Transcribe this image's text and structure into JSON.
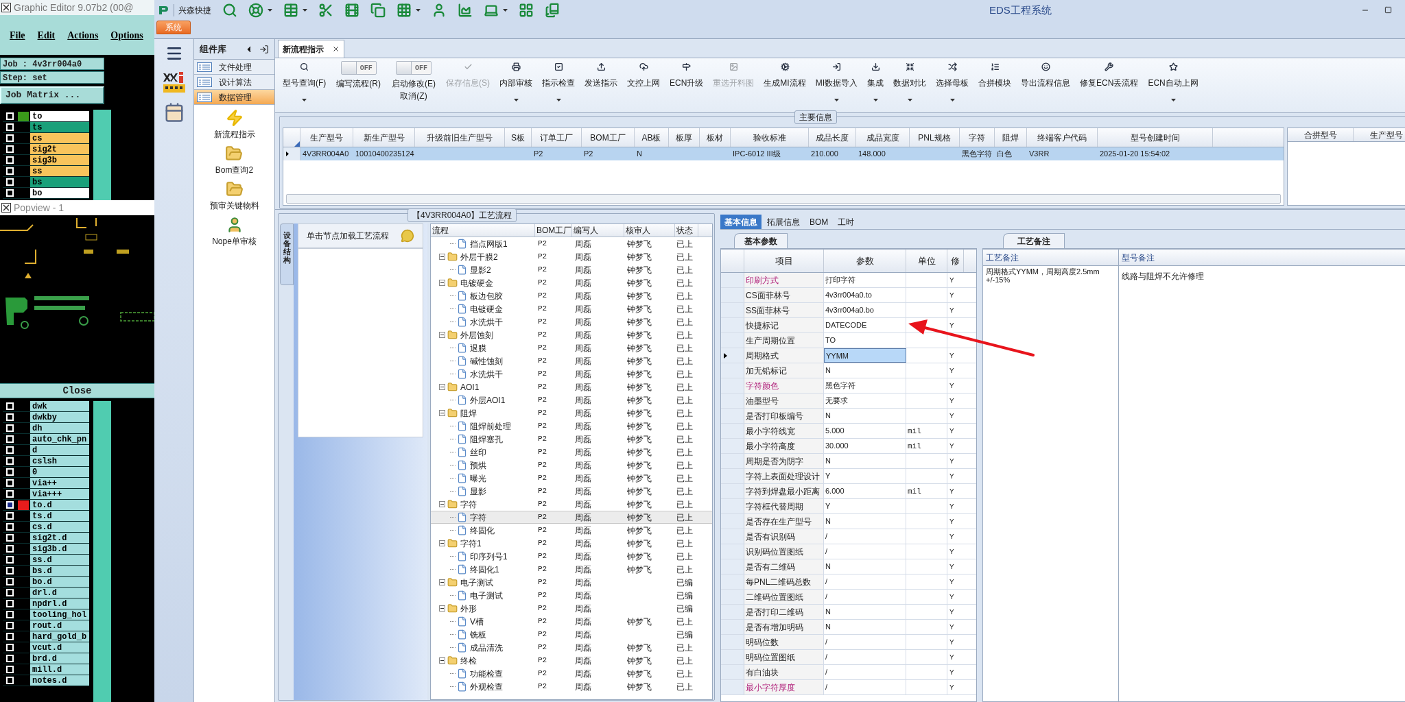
{
  "graphic_editor": {
    "title": "Graphic Editor 9.07b2 (00@",
    "menu": [
      "File",
      "Edit",
      "Actions",
      "Options"
    ],
    "job": "Job : 4v3rr004a0",
    "step": "Step: set",
    "matrix_button": "Job Matrix ...",
    "layers": [
      {
        "name": "to",
        "color": "#ffffff",
        "displayed": true,
        "selected": false
      },
      {
        "name": "ts",
        "color": "#1aa07a",
        "displayed": false,
        "selected": false
      },
      {
        "name": "cs",
        "color": "#f8c45c",
        "displayed": false,
        "selected": false
      },
      {
        "name": "sig2t",
        "color": "#f8c45c",
        "displayed": false,
        "selected": false
      },
      {
        "name": "sig3b",
        "color": "#f8c45c",
        "displayed": false,
        "selected": false
      },
      {
        "name": "ss",
        "color": "#f8c45c",
        "displayed": false,
        "selected": false
      },
      {
        "name": "bs",
        "color": "#1aa07a",
        "displayed": false,
        "selected": false
      },
      {
        "name": "bo",
        "color": "#ffffff",
        "displayed": false,
        "selected": false
      }
    ],
    "popview_title": "Popview - 1",
    "close_button": "Close",
    "layers_2": [
      {
        "name": "dwk",
        "selected": false,
        "displayed": false
      },
      {
        "name": "dwkby",
        "selected": false,
        "displayed": false
      },
      {
        "name": "dh",
        "selected": false,
        "displayed": false
      },
      {
        "name": "auto_chk_pn",
        "selected": false,
        "displayed": false
      },
      {
        "name": "d",
        "selected": false,
        "displayed": false
      },
      {
        "name": "cslsh",
        "selected": false,
        "displayed": false
      },
      {
        "name": "0",
        "selected": false,
        "displayed": false
      },
      {
        "name": "via++",
        "selected": false,
        "displayed": false
      },
      {
        "name": "via+++",
        "selected": false,
        "displayed": false
      },
      {
        "name": "to.d",
        "selected": true,
        "displayed": true
      },
      {
        "name": "ts.d",
        "selected": false,
        "displayed": false
      },
      {
        "name": "cs.d",
        "selected": false,
        "displayed": false
      },
      {
        "name": "sig2t.d",
        "selected": false,
        "displayed": false
      },
      {
        "name": "sig3b.d",
        "selected": false,
        "displayed": false
      },
      {
        "name": "ss.d",
        "selected": false,
        "displayed": false
      },
      {
        "name": "bs.d",
        "selected": false,
        "displayed": false
      },
      {
        "name": "bo.d",
        "selected": false,
        "displayed": false
      },
      {
        "name": "drl.d",
        "selected": false,
        "displayed": false
      },
      {
        "name": "npdrl.d",
        "selected": false,
        "displayed": false
      },
      {
        "name": "tooling_hol",
        "selected": false,
        "displayed": false
      },
      {
        "name": "rout.d",
        "selected": false,
        "displayed": false
      },
      {
        "name": "hard_gold_b",
        "selected": false,
        "displayed": false
      },
      {
        "name": "vcut.d",
        "selected": false,
        "displayed": false
      },
      {
        "name": "brd.d",
        "selected": false,
        "displayed": false
      },
      {
        "name": "mill.d",
        "selected": false,
        "displayed": false
      },
      {
        "name": "notes.d",
        "selected": false,
        "displayed": false
      }
    ]
  },
  "app": {
    "brand": "兴森快捷",
    "title": "EDS工程系统",
    "system_tab": "系统"
  },
  "library": {
    "title": "组件库",
    "items": [
      {
        "label": "文件处理",
        "selected": false
      },
      {
        "label": "设计算法",
        "selected": false
      },
      {
        "label": "数据管理",
        "selected": true
      }
    ],
    "tools": [
      "新流程指示",
      "Bom查询2",
      "预审关键物料",
      "Nope单审核"
    ]
  },
  "doc_tab": {
    "label": "新流程指示"
  },
  "ribbon": [
    {
      "kind": "button",
      "label": "型号查询(F)",
      "dropdown": true,
      "disabled": false
    },
    {
      "kind": "toggle",
      "label": "编写流程(R)",
      "on": false,
      "state_text": "OFF"
    },
    {
      "kind": "toggle",
      "label": "启动修改(E)",
      "second_line": "取消(Z)",
      "on": false,
      "state_text": "OFF"
    },
    {
      "kind": "button",
      "label": "保存信息(S)",
      "dropdown": false,
      "disabled": true
    },
    {
      "kind": "button",
      "label": "内部审核",
      "dropdown": true,
      "disabled": false
    },
    {
      "kind": "button",
      "label": "指示检查",
      "dropdown": true,
      "disabled": false
    },
    {
      "kind": "button",
      "label": "发送指示",
      "dropdown": false,
      "disabled": false
    },
    {
      "kind": "button",
      "label": "文控上网",
      "dropdown": false,
      "disabled": false
    },
    {
      "kind": "button",
      "label": "ECN升级",
      "dropdown": false,
      "disabled": false
    },
    {
      "kind": "button",
      "label": "重选开料图",
      "dropdown": false,
      "disabled": true
    },
    {
      "kind": "button",
      "label": "生成MI流程",
      "dropdown": false,
      "disabled": false
    },
    {
      "kind": "button",
      "label": "MI数据导入",
      "dropdown": true,
      "disabled": false
    },
    {
      "kind": "button",
      "label": "集成",
      "dropdown": true,
      "disabled": false
    },
    {
      "kind": "button",
      "label": "数据对比",
      "dropdown": true,
      "disabled": false
    },
    {
      "kind": "button",
      "label": "选择母板",
      "dropdown": true,
      "disabled": false
    },
    {
      "kind": "button",
      "label": "合拼模块",
      "dropdown": false,
      "disabled": false
    },
    {
      "kind": "button",
      "label": "导出流程信息",
      "dropdown": false,
      "disabled": false
    },
    {
      "kind": "button",
      "label": "修复ECN丢流程",
      "dropdown": false,
      "disabled": false
    },
    {
      "kind": "button",
      "label": "ECN自动上网",
      "dropdown": true,
      "disabled": false
    }
  ],
  "main_info": {
    "title": "主要信息",
    "columns": [
      "生产型号",
      "新生产型号",
      "升级前旧生产型号",
      "S板",
      "订单工厂",
      "BOM工厂",
      "AB板",
      "板厚",
      "板材",
      "验收标准",
      "成品长度",
      "成品宽度",
      "PNL规格",
      "字符",
      "阻焊",
      "终端客户代码",
      "型号创建时间"
    ],
    "rows": [
      {
        "selected": true,
        "cells": [
          "4V3RR004A0",
          "10010400235124",
          null,
          null,
          "P2",
          "P2",
          "N",
          null,
          null,
          "IPC-6012 III级",
          "210.000",
          "148.000",
          null,
          "黑色字符",
          "白色",
          "V3RR",
          "2025-01-20 15:54:02"
        ]
      }
    ],
    "side_columns": [
      "合拼型号",
      "生产型号"
    ]
  },
  "process": {
    "title": "【4V3RR004A0】工艺流程",
    "side_tab": "设备结构",
    "hint": "单击节点加载工艺流程",
    "columns": [
      "流程",
      "BOM工厂",
      "编写人",
      "核审人",
      "状态"
    ],
    "tree": [
      {
        "children": [
          {
            "label": "挡点网版1",
            "selected": false,
            "bom": "P2",
            "writer": "周磊",
            "reviewer": "钟梦飞",
            "status": "已上"
          }
        ]
      },
      {
        "label": "外层干膜2",
        "kind": "folder",
        "expanded": true,
        "selected": false,
        "bom": "P2",
        "writer": "周磊",
        "reviewer": "钟梦飞",
        "status": "已上",
        "children": [
          {
            "label": "显影2",
            "selected": false,
            "bom": "P2",
            "writer": "周磊",
            "reviewer": "钟梦飞",
            "status": "已上"
          }
        ]
      },
      {
        "label": "电镀硬金",
        "kind": "folder",
        "expanded": true,
        "selected": false,
        "bom": "P2",
        "writer": "周磊",
        "reviewer": "钟梦飞",
        "status": "已上",
        "children": [
          {
            "label": "板边包胶",
            "selected": false,
            "bom": "P2",
            "writer": "周磊",
            "reviewer": "钟梦飞",
            "status": "已上"
          },
          {
            "label": "电镀硬金",
            "selected": false,
            "bom": "P2",
            "writer": "周磊",
            "reviewer": "钟梦飞",
            "status": "已上"
          },
          {
            "label": "水洗烘干",
            "selected": false,
            "bom": "P2",
            "writer": "周磊",
            "reviewer": "钟梦飞",
            "status": "已上"
          }
        ]
      },
      {
        "label": "外层蚀刻",
        "kind": "folder",
        "expanded": true,
        "selected": false,
        "bom": "P2",
        "writer": "周磊",
        "reviewer": "钟梦飞",
        "status": "已上",
        "children": [
          {
            "label": "退膜",
            "selected": false,
            "bom": "P2",
            "writer": "周磊",
            "reviewer": "钟梦飞",
            "status": "已上"
          },
          {
            "label": "碱性蚀刻",
            "selected": false,
            "bom": "P2",
            "writer": "周磊",
            "reviewer": "钟梦飞",
            "status": "已上"
          },
          {
            "label": "水洗烘干",
            "selected": false,
            "bom": "P2",
            "writer": "周磊",
            "reviewer": "钟梦飞",
            "status": "已上"
          }
        ]
      },
      {
        "label": "AOI1",
        "kind": "folder",
        "expanded": true,
        "selected": false,
        "bom": "P2",
        "writer": "周磊",
        "reviewer": "钟梦飞",
        "status": "已上",
        "children": [
          {
            "label": "外层AOI1",
            "selected": false,
            "bom": "P2",
            "writer": "周磊",
            "reviewer": "钟梦飞",
            "status": "已上"
          }
        ]
      },
      {
        "label": "阻焊",
        "kind": "folder",
        "expanded": true,
        "selected": false,
        "bom": "P2",
        "writer": "周磊",
        "reviewer": "钟梦飞",
        "status": "已上",
        "children": [
          {
            "label": "阻焊前处理",
            "selected": false,
            "bom": "P2",
            "writer": "周磊",
            "reviewer": "钟梦飞",
            "status": "已上"
          },
          {
            "label": "阻焊塞孔",
            "selected": false,
            "bom": "P2",
            "writer": "周磊",
            "reviewer": "钟梦飞",
            "status": "已上"
          },
          {
            "label": "丝印",
            "selected": false,
            "bom": "P2",
            "writer": "周磊",
            "reviewer": "钟梦飞",
            "status": "已上"
          },
          {
            "label": "预烘",
            "selected": false,
            "bom": "P2",
            "writer": "周磊",
            "reviewer": "钟梦飞",
            "status": "已上"
          },
          {
            "label": "曝光",
            "selected": false,
            "bom": "P2",
            "writer": "周磊",
            "reviewer": "钟梦飞",
            "status": "已上"
          },
          {
            "label": "显影",
            "selected": false,
            "bom": "P2",
            "writer": "周磊",
            "reviewer": "钟梦飞",
            "status": "已上"
          }
        ]
      },
      {
        "label": "字符",
        "kind": "folder",
        "expanded": true,
        "selected": false,
        "bom": "P2",
        "writer": "周磊",
        "reviewer": "钟梦飞",
        "status": "已上",
        "children": [
          {
            "label": "字符",
            "selected": true,
            "bom": "P2",
            "writer": "周磊",
            "reviewer": "钟梦飞",
            "status": "已上"
          },
          {
            "label": "终固化",
            "selected": false,
            "bom": "P2",
            "writer": "周磊",
            "reviewer": "钟梦飞",
            "status": "已上"
          }
        ]
      },
      {
        "label": "字符1",
        "kind": "folder",
        "expanded": true,
        "selected": false,
        "bom": "P2",
        "writer": "周磊",
        "reviewer": "钟梦飞",
        "status": "已上",
        "children": [
          {
            "label": "印序列号1",
            "selected": false,
            "bom": "P2",
            "writer": "周磊",
            "reviewer": "钟梦飞",
            "status": "已上"
          },
          {
            "label": "终固化1",
            "selected": false,
            "bom": "P2",
            "writer": "周磊",
            "reviewer": "钟梦飞",
            "status": "已上"
          }
        ]
      },
      {
        "label": "电子测试",
        "kind": "folder",
        "expanded": true,
        "selected": false,
        "bom": "P2",
        "writer": "周磊",
        "status": "已编",
        "children": [
          {
            "label": "电子测试",
            "selected": false,
            "bom": "P2",
            "writer": "周磊",
            "status": "已编"
          }
        ]
      },
      {
        "label": "外形",
        "kind": "folder",
        "expanded": true,
        "selected": false,
        "bom": "P2",
        "writer": "周磊",
        "status": "已编",
        "children": [
          {
            "label": "V槽",
            "selected": false,
            "bom": "P2",
            "writer": "周磊",
            "reviewer": "钟梦飞",
            "status": "已上"
          },
          {
            "label": "铣板",
            "selected": false,
            "bom": "P2",
            "writer": "周磊",
            "status": "已编"
          },
          {
            "label": "成品清洗",
            "selected": false,
            "bom": "P2",
            "writer": "周磊",
            "reviewer": "钟梦飞",
            "status": "已上"
          }
        ]
      },
      {
        "label": "终检",
        "kind": "folder",
        "expanded": true,
        "selected": false,
        "bom": "P2",
        "writer": "周磊",
        "reviewer": "钟梦飞",
        "status": "已上",
        "children": [
          {
            "label": "功能检查",
            "selected": false,
            "bom": "P2",
            "writer": "周磊",
            "reviewer": "钟梦飞",
            "status": "已上"
          },
          {
            "label": "外观检查",
            "selected": false,
            "bom": "P2",
            "writer": "周磊",
            "reviewer": "钟梦飞",
            "status": "已上"
          }
        ]
      }
    ]
  },
  "detail_tabs": [
    {
      "label": "基本信息",
      "selected": true
    },
    {
      "label": "拓展信息",
      "selected": false
    },
    {
      "label": "BOM",
      "selected": false
    },
    {
      "label": "工时",
      "selected": false
    }
  ],
  "params": {
    "tab": "基本参数",
    "columns": [
      "项目",
      "参数",
      "单位",
      "修"
    ],
    "rows": [
      {
        "item": "印刷方式",
        "value": "打印字符",
        "flag": "Y",
        "marked": true,
        "selected": false
      },
      {
        "item": "CS面菲林号",
        "value": "4v3rr004a0.to",
        "flag": "Y",
        "marked": false,
        "selected": false
      },
      {
        "item": "SS面菲林号",
        "value": "4v3rr004a0.bo",
        "flag": "Y",
        "marked": false,
        "selected": false
      },
      {
        "item": "快捷标记",
        "value": "DATECODE",
        "flag": "Y",
        "marked": false,
        "selected": false
      },
      {
        "item": "生产周期位置",
        "value": "TO",
        "marked": false,
        "selected": false
      },
      {
        "item": "周期格式",
        "value": "YYMM",
        "flag": "Y",
        "marked": false,
        "selected": true
      },
      {
        "item": "加无铅标记",
        "value": "N",
        "flag": "Y",
        "marked": false,
        "selected": false
      },
      {
        "item": "字符颜色",
        "value": "黑色字符",
        "flag": "Y",
        "marked": true,
        "selected": false
      },
      {
        "item": "油墨型号",
        "value": "无要求",
        "flag": "Y",
        "marked": false,
        "selected": false
      },
      {
        "item": "是否打印板编号",
        "value": "N",
        "flag": "Y",
        "marked": false,
        "selected": false
      },
      {
        "item": "最小字符线宽",
        "value": "5.000",
        "unit": "mil",
        "flag": "Y",
        "marked": false,
        "selected": false
      },
      {
        "item": "最小字符高度",
        "value": "30.000",
        "unit": "mil",
        "flag": "Y",
        "marked": false,
        "selected": false
      },
      {
        "item": "周期是否为阴字",
        "value": "N",
        "flag": "Y",
        "marked": false,
        "selected": false
      },
      {
        "item": "字符上表面处理设计",
        "value": "Y",
        "flag": "Y",
        "marked": false,
        "selected": false
      },
      {
        "item": "字符到焊盘最小距离",
        "value": "6.000",
        "unit": "mil",
        "flag": "Y",
        "marked": false,
        "selected": false
      },
      {
        "item": "字符框代替周期",
        "value": "Y",
        "flag": "Y",
        "marked": false,
        "selected": false
      },
      {
        "item": "是否存在生产型号",
        "value": "N",
        "flag": "Y",
        "marked": false,
        "selected": false
      },
      {
        "item": "是否有识别码",
        "value": "/",
        "flag": "Y",
        "marked": false,
        "selected": false
      },
      {
        "item": "识别码位置图纸",
        "value": "/",
        "flag": "Y",
        "marked": false,
        "selected": false
      },
      {
        "item": "是否有二维码",
        "value": "N",
        "flag": "Y",
        "marked": false,
        "selected": false
      },
      {
        "item": "每PNL二维码总数",
        "value": "/",
        "flag": "Y",
        "marked": false,
        "selected": false
      },
      {
        "item": "二维码位置图纸",
        "value": "/",
        "flag": "Y",
        "marked": false,
        "selected": false
      },
      {
        "item": "是否打印二维码",
        "value": "N",
        "flag": "Y",
        "marked": false,
        "selected": false
      },
      {
        "item": "是否有增加明码",
        "value": "N",
        "flag": "Y",
        "marked": false,
        "selected": false
      },
      {
        "item": "明码位数",
        "value": "/",
        "flag": "Y",
        "marked": false,
        "selected": false
      },
      {
        "item": "明码位置图纸",
        "value": "/",
        "flag": "Y",
        "marked": false,
        "selected": false
      },
      {
        "item": "有白油块",
        "value": "/",
        "flag": "Y",
        "marked": false,
        "selected": false
      },
      {
        "item": "最小字符厚度",
        "value": "/",
        "flag": "Y",
        "marked": true,
        "selected": false
      }
    ]
  },
  "notes": {
    "tab": "工艺备注",
    "columns": [
      "工艺备注",
      "型号备注"
    ],
    "process_note": "周期格式YYMM，周期高度2.5mm +/-15%",
    "model_note": "线路与阻焊不允许修理"
  }
}
